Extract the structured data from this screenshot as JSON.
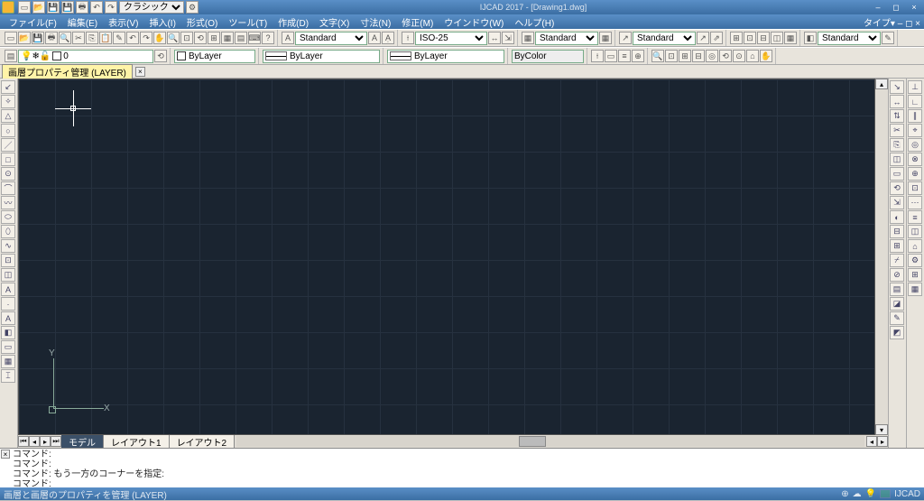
{
  "app": {
    "title": "IJCAD 2017 - [Drawing1.dwg]"
  },
  "workspace_selector": "クラシック",
  "menubar": {
    "items": [
      "ファイル(F)",
      "編集(E)",
      "表示(V)",
      "挿入(I)",
      "形式(O)",
      "ツール(T)",
      "作成(D)",
      "文字(X)",
      "寸法(N)",
      "修正(M)",
      "ウインドウ(W)",
      "ヘルプ(H)"
    ],
    "right_label": "タイプ▾ ‒ ◻ ×"
  },
  "toolbar1": {
    "text_style": "Standard",
    "dim_style": "ISO-25",
    "table_style": "Standard",
    "mleader_style": "Standard",
    "misc_style": "Standard"
  },
  "toolbar2": {
    "layer_name": "0",
    "color_label": "ByLayer",
    "linetype_label": "ByLayer",
    "lineweight_label": "ByLayer",
    "plotstyle_label": "ByColor"
  },
  "doc_tab": {
    "label": "画層プロパティ管理 (LAYER)"
  },
  "model_tabs": {
    "model": "モデル",
    "layout1": "レイアウト1",
    "layout2": "レイアウト2"
  },
  "ucs": {
    "x": "X",
    "y": "Y"
  },
  "command": {
    "lines": [
      "コマンド:",
      "コマンド:",
      "コマンド: もう一方のコーナーを指定:",
      "コマンド:"
    ]
  },
  "status": {
    "hint": "画層と画層のプロパティを管理 (LAYER)",
    "product": "IJCAD"
  },
  "left_tools": [
    "↙",
    "✧",
    "△",
    "○",
    "／",
    "□",
    "⊙",
    "⌒",
    "〰",
    "⬭",
    "⬯",
    "∿",
    "⊡",
    "◫",
    "A",
    "·",
    "A",
    "◧",
    "▭",
    "▦",
    "⌶"
  ],
  "right_tools_a": [
    "↘",
    "↔",
    "⇅",
    "✂",
    "⎘",
    "◫",
    "▭",
    "⟲",
    "⇲",
    "◐",
    "⊟",
    "⊞",
    "⌿",
    "⊘",
    "▤",
    "◪",
    "✎",
    "◩"
  ],
  "right_tools_b": [
    "⊥",
    "∟",
    "∥",
    "⌖",
    "◎",
    "⊗",
    "⊕",
    "⊡",
    "⋯",
    "≡",
    "◫",
    "⌂",
    "⚙",
    "⊞",
    "▦"
  ]
}
